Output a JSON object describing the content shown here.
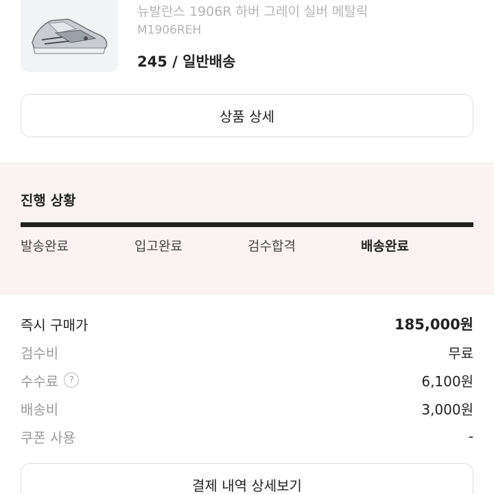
{
  "product": {
    "name": "뉴발란스 1906R 하버 그레이 실버 메탈릭",
    "model": "M1906REH",
    "option": "245 / 일반배송",
    "image_icon": "sneaker-image"
  },
  "buttons": {
    "detail": "상품 상세",
    "receipt": "결제 내역 상세보기"
  },
  "progress": {
    "title": "진행 상황",
    "steps": [
      "발송완료",
      "입고완료",
      "검수합격",
      "배송완료"
    ],
    "current_index": 3,
    "fill_fraction": 1.0
  },
  "prices": {
    "buy_now": {
      "label": "즉시 구매가",
      "value": "185,000원"
    },
    "inspection": {
      "label": "검수비",
      "value": "무료"
    },
    "fee": {
      "label": "수수료",
      "value": "6,100원",
      "help": "?"
    },
    "shipping": {
      "label": "배송비",
      "value": "3,000원"
    },
    "coupon": {
      "label": "쿠폰 사용",
      "value": "-"
    }
  },
  "colors": {
    "accent": "#222222",
    "progress_bg": "#fbf3f3"
  }
}
